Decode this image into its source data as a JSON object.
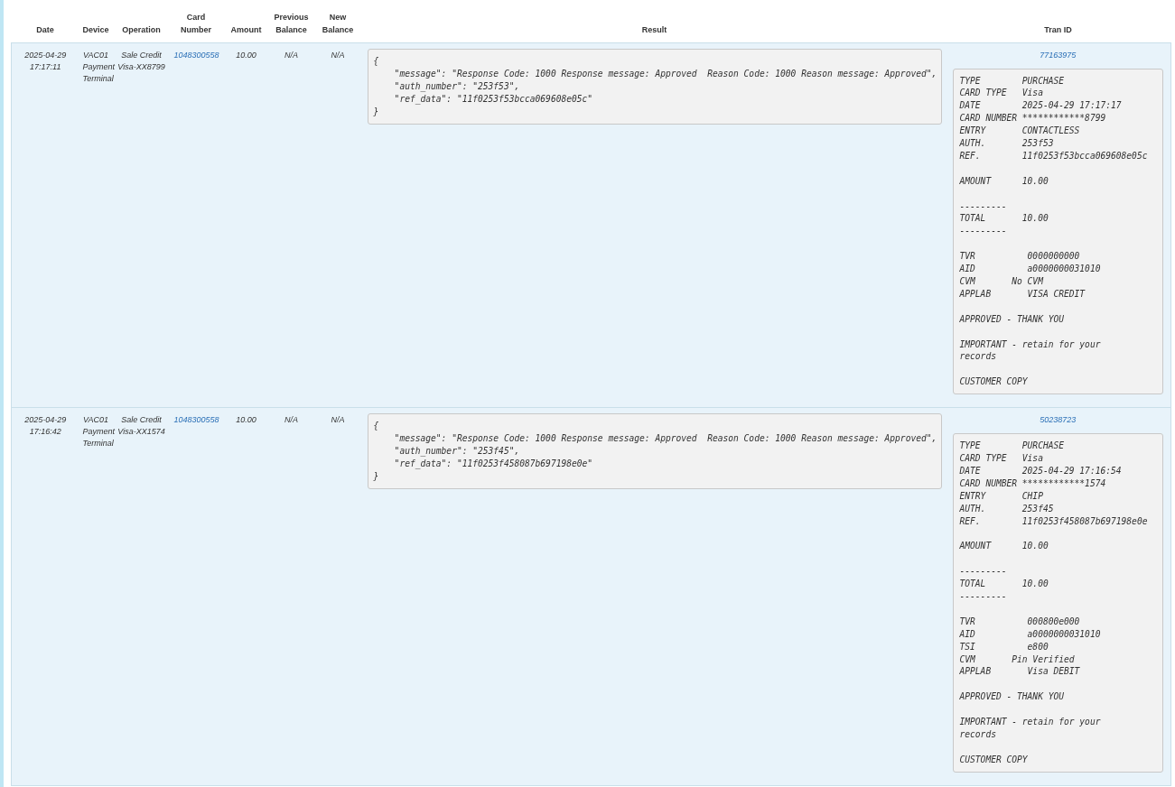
{
  "table": {
    "columns": [
      "Date",
      "Device",
      "Operation",
      "Card Number",
      "Amount",
      "Previous Balance",
      "New Balance",
      "Result",
      "Tran ID"
    ],
    "rows": [
      {
        "date": "2025-04-29 17:17:11",
        "device": "VAC01 Payment Terminal",
        "operation": "Sale Credit Visa-XX8799",
        "card_number": "1048300558",
        "amount": "10.00",
        "previous_balance": "N/A",
        "new_balance": "N/A",
        "result": "{\n    \"message\": \"Response Code: 1000 Response message: Approved  Reason Code: 1000 Reason message: Approved\",\n    \"auth_number\": \"253f53\",\n    \"ref_data\": \"11f0253f53bcca069608e05c\"\n}",
        "tran_id": "77163975",
        "receipt": "TYPE        PURCHASE\nCARD TYPE   Visa\nDATE        2025-04-29 17:17:17\nCARD NUMBER ************8799\nENTRY       CONTACTLESS\nAUTH.       253f53\nREF.        11f0253f53bcca069608e05c\n\nAMOUNT      10.00\n\n---------\nTOTAL       10.00\n---------\n\nTVR          0000000000\nAID          a0000000031010\nCVM       No CVM\nAPPLAB       VISA CREDIT\n\nAPPROVED - THANK YOU\n\nIMPORTANT - retain for your\nrecords\n\nCUSTOMER COPY"
      },
      {
        "date": "2025-04-29 17:16:42",
        "device": "VAC01 Payment Terminal",
        "operation": "Sale Credit Visa-XX1574",
        "card_number": "1048300558",
        "amount": "10.00",
        "previous_balance": "N/A",
        "new_balance": "N/A",
        "result": "{\n    \"message\": \"Response Code: 1000 Response message: Approved  Reason Code: 1000 Reason message: Approved\",\n    \"auth_number\": \"253f45\",\n    \"ref_data\": \"11f0253f458087b697198e0e\"\n}",
        "tran_id": "50238723",
        "receipt": "TYPE        PURCHASE\nCARD TYPE   Visa\nDATE        2025-04-29 17:16:54\nCARD NUMBER ************1574\nENTRY       CHIP\nAUTH.       253f45\nREF.        11f0253f458087b697198e0e\n\nAMOUNT      10.00\n\n---------\nTOTAL       10.00\n---------\n\nTVR          000800e000\nAID          a0000000031010\nTSI          e800\nCVM       Pin Verified\nAPPLAB       Visa DEBIT\n\nAPPROVED - THANK YOU\n\nIMPORTANT - retain for your\nrecords\n\nCUSTOMER COPY"
      }
    ]
  }
}
